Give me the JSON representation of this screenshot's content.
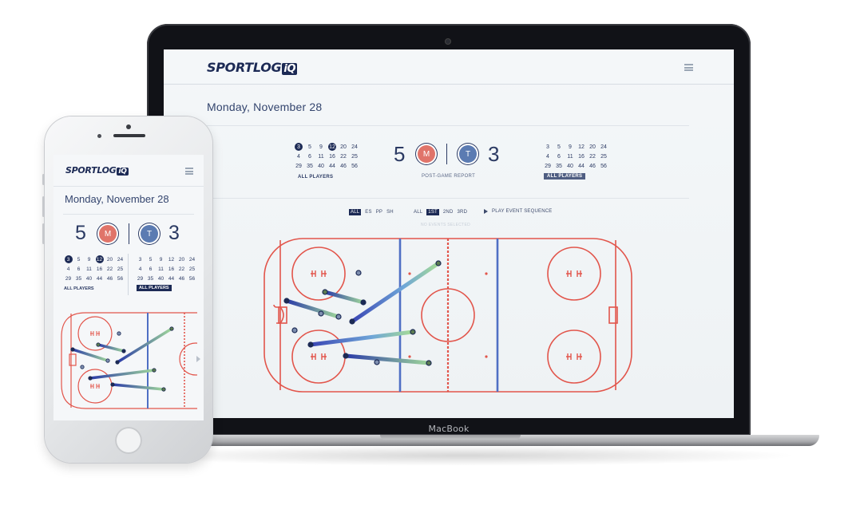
{
  "brand": {
    "name": "SPORTLOG",
    "suffix": "iQ"
  },
  "laptop": {
    "device_label": "MacBook"
  },
  "game": {
    "date": "Monday, November 28",
    "home": {
      "score": "5",
      "badge": "M",
      "color": "#e0746a"
    },
    "away": {
      "score": "3",
      "badge": "T",
      "color": "#5b7bb2"
    },
    "report_label": "POST-GAME REPORT",
    "home_players": [
      "3",
      "5",
      "9",
      "12",
      "20",
      "24",
      "4",
      "6",
      "11",
      "16",
      "22",
      "25",
      "29",
      "35",
      "40",
      "44",
      "46",
      "56"
    ],
    "home_selected": [
      "3",
      "12"
    ],
    "away_players": [
      "3",
      "5",
      "9",
      "12",
      "20",
      "24",
      "4",
      "6",
      "11",
      "16",
      "22",
      "25",
      "29",
      "35",
      "40",
      "44",
      "46",
      "56"
    ],
    "all_players_label": "ALL PLAYERS"
  },
  "filters": {
    "strength": [
      "ALL",
      "ES",
      "PP",
      "SH"
    ],
    "strength_selected": "ALL",
    "period": [
      "ALL",
      "1ST",
      "2ND",
      "3RD"
    ],
    "period_selected": "1ST",
    "play_label": "PLAY EVENT SEQUENCE",
    "no_events_label": "NO EVENTS SELECTED"
  },
  "colors": {
    "rink_line": "#e2554b",
    "blue_line": "#4f6fc4",
    "navy": "#1c2a55"
  }
}
